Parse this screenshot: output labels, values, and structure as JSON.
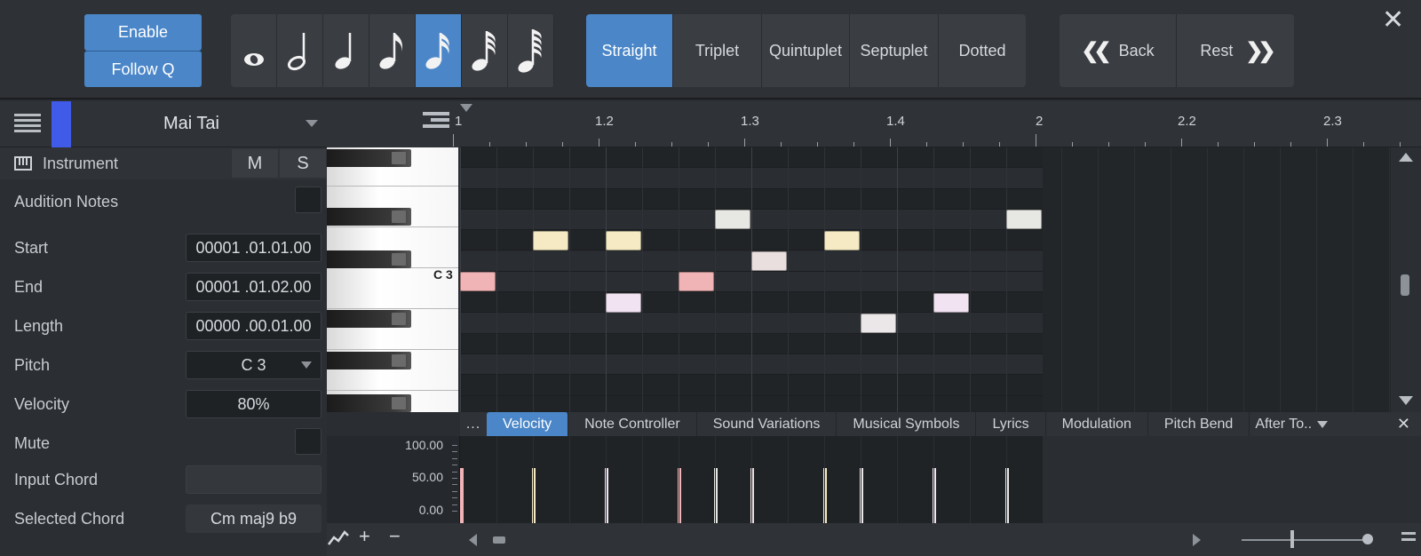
{
  "toolbar": {
    "enable_label": "Enable",
    "follow_q_label": "Follow Q",
    "note_values": [
      {
        "name": "whole-note",
        "active": false
      },
      {
        "name": "half-note",
        "active": false
      },
      {
        "name": "quarter-note",
        "active": false
      },
      {
        "name": "eighth-note",
        "active": false
      },
      {
        "name": "sixteenth-note",
        "active": true
      },
      {
        "name": "thirty-second-note",
        "active": false
      },
      {
        "name": "sixty-fourth-note",
        "active": false
      }
    ],
    "tuplets": [
      {
        "label": "Straight",
        "active": true
      },
      {
        "label": "Triplet",
        "active": false
      },
      {
        "label": "Quintuplet",
        "active": false
      },
      {
        "label": "Septuplet",
        "active": false
      },
      {
        "label": "Dotted",
        "active": false
      }
    ],
    "back_label": "Back",
    "rest_label": "Rest",
    "close_glyph": "✕"
  },
  "inspector": {
    "track_name": "Mai Tai",
    "track_color": "#3f5be8",
    "instrument_label": "Instrument",
    "mute_label": "M",
    "solo_label": "S",
    "audition_notes_label": "Audition Notes",
    "fields": {
      "start": {
        "label": "Start",
        "value": "00001 .01.01.00"
      },
      "end": {
        "label": "End",
        "value": "00001 .01.02.00"
      },
      "length": {
        "label": "Length",
        "value": "00000 .00.01.00"
      },
      "pitch": {
        "label": "Pitch",
        "value": "C 3"
      },
      "velocity": {
        "label": "Velocity",
        "value": "80%"
      },
      "mute": {
        "label": "Mute"
      },
      "input_chord": {
        "label": "Input Chord",
        "value": ""
      },
      "selected_chord": {
        "label": "Selected Chord",
        "value": "Cm maj9 b9"
      }
    }
  },
  "ruler": {
    "labels": [
      "1",
      "1.2",
      "1.3",
      "1.4",
      "2",
      "2.2",
      "2.3"
    ]
  },
  "piano": {
    "c3_label": "C 3"
  },
  "notes": [
    {
      "step": 0,
      "row": 6,
      "color": "#f0b4b6"
    },
    {
      "step": 2,
      "row": 4,
      "color": "#f5eac4"
    },
    {
      "step": 4,
      "row": 4,
      "color": "#f5eac4"
    },
    {
      "step": 4,
      "row": 7,
      "color": "#f1e3f2"
    },
    {
      "step": 6,
      "row": 6,
      "color": "#f0b4b6"
    },
    {
      "step": 7,
      "row": 3,
      "color": "#e7e8e4"
    },
    {
      "step": 8,
      "row": 5,
      "color": "#eadfdf"
    },
    {
      "step": 10,
      "row": 4,
      "color": "#f5eac4"
    },
    {
      "step": 11,
      "row": 8,
      "color": "#ebe7e8"
    },
    {
      "step": 13,
      "row": 7,
      "color": "#f1e3f2"
    },
    {
      "step": 15,
      "row": 3,
      "color": "#e7e8e4"
    }
  ],
  "lanes": {
    "more_label": "...",
    "tabs": [
      {
        "label": "Velocity",
        "active": true
      },
      {
        "label": "Note Controller",
        "active": false
      },
      {
        "label": "Sound Variations",
        "active": false
      },
      {
        "label": "Musical Symbols",
        "active": false
      },
      {
        "label": "Lyrics",
        "active": false
      },
      {
        "label": "Modulation",
        "active": false
      },
      {
        "label": "Pitch Bend",
        "active": false
      },
      {
        "label": "After To..",
        "active": false
      }
    ],
    "close_glyph": "✕"
  },
  "velocity": {
    "scale_labels": [
      "100.00",
      "50.00",
      "0.00"
    ],
    "bars": [
      {
        "step": 0,
        "value": 80,
        "color": "#f0b4b6"
      },
      {
        "step": 2,
        "value": 80,
        "color": "#f5eac4"
      },
      {
        "step": 4,
        "value": 80,
        "color": "#f5eac4"
      },
      {
        "step": 4,
        "value": 80,
        "color": "#f1e3f2"
      },
      {
        "step": 6,
        "value": 80,
        "color": "#f0b4b6"
      },
      {
        "step": 7,
        "value": 80,
        "color": "#e7e8e4"
      },
      {
        "step": 8,
        "value": 80,
        "color": "#eadfdf"
      },
      {
        "step": 10,
        "value": 80,
        "color": "#f5eac4"
      },
      {
        "step": 11,
        "value": 80,
        "color": "#ebe7e8"
      },
      {
        "step": 13,
        "value": 80,
        "color": "#f1e3f2"
      },
      {
        "step": 15,
        "value": 80,
        "color": "#e7e8e4"
      }
    ]
  },
  "colors": {
    "accent": "#4a86c8"
  }
}
